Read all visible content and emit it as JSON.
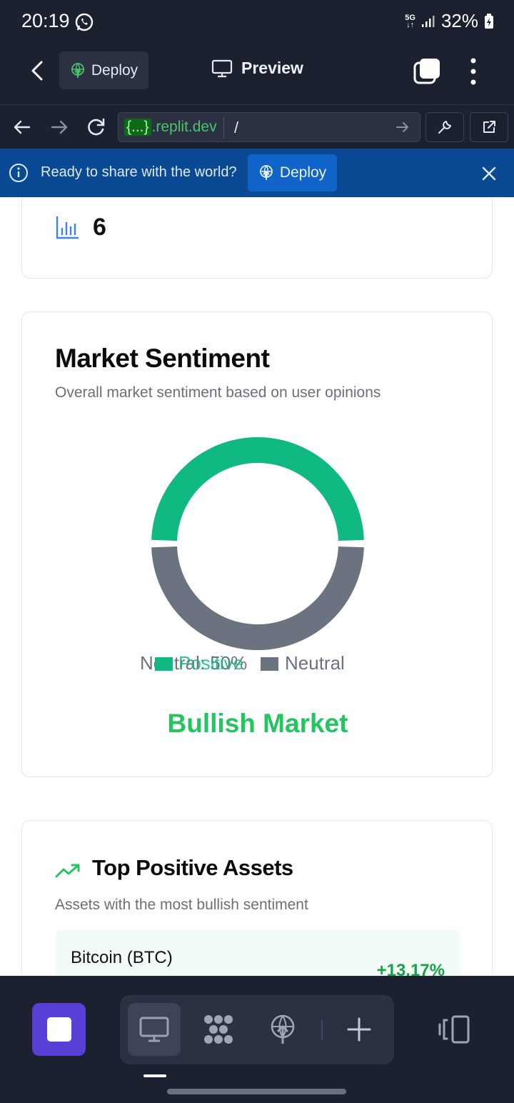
{
  "status_bar": {
    "time": "20:19",
    "network_top": "5G",
    "network_bottom": "↓↑",
    "battery": "32%"
  },
  "top_bar": {
    "deploy_label": "Deploy",
    "preview_label": "Preview"
  },
  "url_bar": {
    "host_prefix": "{...}",
    "host_domain": ".replit.dev",
    "path": "/"
  },
  "banner": {
    "message": "Ready to share with the world?",
    "deploy_label": "Deploy"
  },
  "stat_card": {
    "value": "6"
  },
  "sentiment": {
    "title": "Market Sentiment",
    "subtitle": "Overall market sentiment based on user opinions",
    "overlap_label": "Neutral: 50%",
    "verdict": "Bullish Market"
  },
  "chart_data": {
    "type": "pie",
    "donut": true,
    "categories": [
      "Positive",
      "Neutral"
    ],
    "values": [
      50,
      50
    ],
    "colors": [
      "#10b981",
      "#6b7280"
    ],
    "legend": [
      "Positive",
      "Neutral"
    ],
    "legend_placement": "bottom",
    "title": ""
  },
  "top_assets": {
    "title": "Top Positive Assets",
    "subtitle": "Assets with the most bullish sentiment",
    "items": [
      {
        "name": "Bitcoin (BTC)",
        "change": "+13.17%"
      }
    ]
  },
  "colors": {
    "positive": "#10b981",
    "neutral": "#6b7280",
    "bullish": "#22c55e",
    "accent": "#5a3fd6"
  }
}
